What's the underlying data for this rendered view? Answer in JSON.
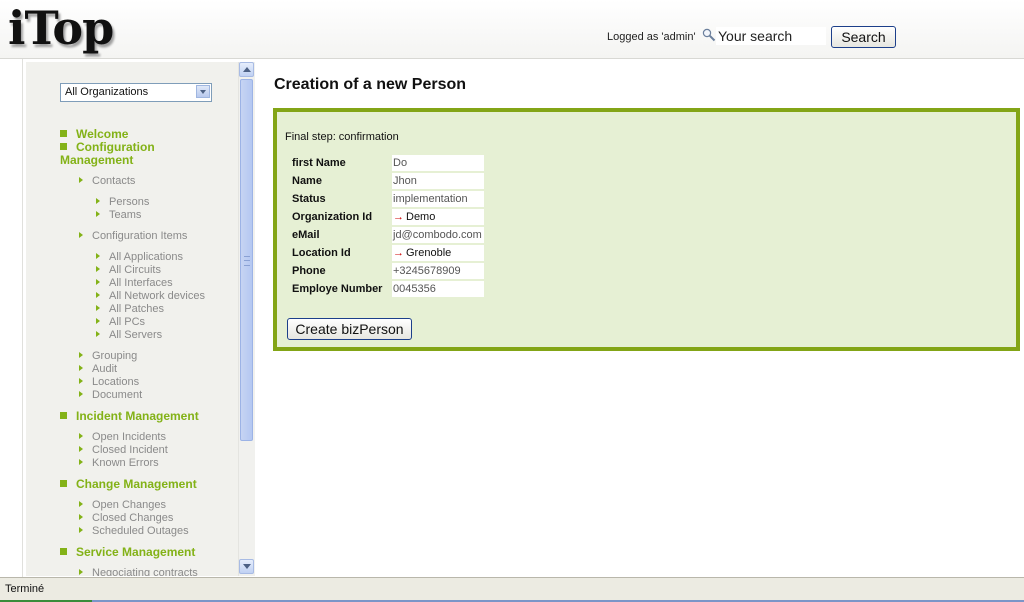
{
  "header": {
    "logo": "iTop",
    "logged_as": "Logged as 'admin'",
    "search_placeholder": "Your search",
    "search_button": "Search"
  },
  "menu": {
    "org_selected": "All Organizations",
    "welcome": "Welcome",
    "config_mgmt": "Configuration Management",
    "contacts": "Contacts",
    "persons": "Persons",
    "teams": "Teams",
    "config_items": "Configuration Items",
    "ci": [
      "All Applications",
      "All Circuits",
      "All Interfaces",
      "All Network devices",
      "All Patches",
      "All PCs",
      "All Servers"
    ],
    "grouping": "Grouping",
    "audit": "Audit",
    "locations": "Locations",
    "document": "Document",
    "incident_mgmt": "Incident Management",
    "incident_items": [
      "Open Incidents",
      "Closed Incident",
      "Known Errors"
    ],
    "change_mgmt": "Change Management",
    "change_items": [
      "Open Changes",
      "Closed Changes",
      "Scheduled Outages"
    ],
    "service_mgmt": "Service Management",
    "service_items": [
      "Negociating contracts"
    ]
  },
  "content": {
    "title": "Creation of a new Person",
    "step": "Final step: confirmation",
    "fields": [
      {
        "label": "first Name",
        "value": "Do"
      },
      {
        "label": "Name",
        "value": "Jhon"
      },
      {
        "label": "Status",
        "value": "implementation"
      },
      {
        "label": "Organization Id",
        "value": "Demo"
      },
      {
        "label": "eMail",
        "value": "jd@combodo.com"
      },
      {
        "label": "Location Id",
        "value": "Grenoble"
      },
      {
        "label": "Phone",
        "value": "+3245678909"
      },
      {
        "label": "Employe Number",
        "value": "0045356"
      }
    ],
    "create_button": "Create bizPerson"
  },
  "status": {
    "text": "Terminé"
  },
  "icons": {
    "search": "magnifier-icon",
    "external_key": "arrow-right-icon"
  },
  "colors": {
    "accent_green": "#83b217",
    "wizard_border": "#83a516",
    "wizard_bg": "#e6f0d4"
  }
}
